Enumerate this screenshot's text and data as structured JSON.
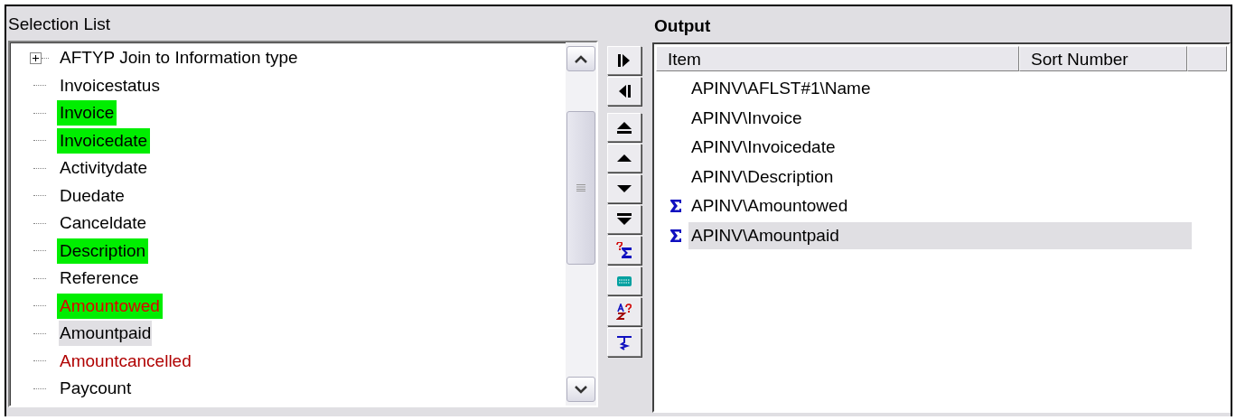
{
  "selection_list": {
    "title": "Selection List",
    "items": [
      {
        "label": "AFTYP  Join to Information type",
        "expandable": true,
        "highlighted": false,
        "selected": false,
        "kind": "default"
      },
      {
        "label": "Invoicestatus",
        "expandable": false,
        "highlighted": false,
        "selected": false,
        "kind": "default"
      },
      {
        "label": "Invoice",
        "expandable": false,
        "highlighted": true,
        "selected": false,
        "kind": "default"
      },
      {
        "label": "Invoicedate",
        "expandable": false,
        "highlighted": true,
        "selected": false,
        "kind": "default"
      },
      {
        "label": "Activitydate",
        "expandable": false,
        "highlighted": false,
        "selected": false,
        "kind": "default"
      },
      {
        "label": "Duedate",
        "expandable": false,
        "highlighted": false,
        "selected": false,
        "kind": "default"
      },
      {
        "label": "Canceldate",
        "expandable": false,
        "highlighted": false,
        "selected": false,
        "kind": "default"
      },
      {
        "label": "Description",
        "expandable": false,
        "highlighted": true,
        "selected": false,
        "kind": "default"
      },
      {
        "label": "Reference",
        "expandable": false,
        "highlighted": false,
        "selected": false,
        "kind": "default"
      },
      {
        "label": "Amountowed",
        "expandable": false,
        "highlighted": true,
        "selected": false,
        "kind": "alert"
      },
      {
        "label": "Amountpaid",
        "expandable": false,
        "highlighted": false,
        "selected": true,
        "kind": "default"
      },
      {
        "label": "Amountcancelled",
        "expandable": false,
        "highlighted": false,
        "selected": false,
        "kind": "cancelled"
      },
      {
        "label": "Paycount",
        "expandable": false,
        "highlighted": false,
        "selected": false,
        "kind": "default"
      }
    ]
  },
  "output": {
    "title": "Output",
    "columns": [
      "Item",
      "Sort Number"
    ],
    "rows": [
      {
        "item": "APINV\\AFLST#1\\Name",
        "sum": false,
        "selected": false
      },
      {
        "item": "APINV\\Invoice",
        "sum": false,
        "selected": false
      },
      {
        "item": "APINV\\Invoicedate",
        "sum": false,
        "selected": false
      },
      {
        "item": "APINV\\Description",
        "sum": false,
        "selected": false
      },
      {
        "item": "APINV\\Amountowed",
        "sum": true,
        "selected": false
      },
      {
        "item": "APINV\\Amountpaid",
        "sum": true,
        "selected": true
      }
    ]
  }
}
